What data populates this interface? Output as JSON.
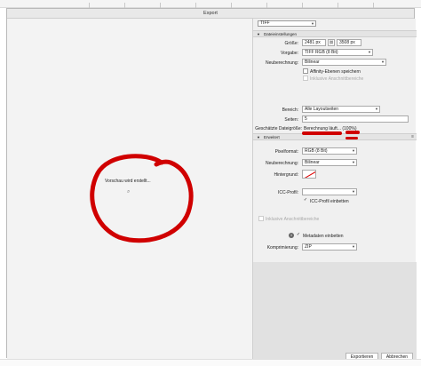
{
  "window": {
    "title": "Export"
  },
  "preview": {
    "status_text": "Vorschau wird erstellt..."
  },
  "format": {
    "selected": "TIFF"
  },
  "file_settings": {
    "header": "Dateieinstellungen",
    "size_label": "Größe:",
    "width_value": "2481 px",
    "height_value": "3508 px",
    "preset_label": "Vorgabe:",
    "preset_value": "TIFF RGB (8 Bit)",
    "resample_label": "Neuberechnung:",
    "resample_value": "Bilinear",
    "affinity_layers_label": "Affinity-Ebenen speichern",
    "bleed_label": "Inklusive Anschnittbereiche",
    "area_label": "Bereich:",
    "area_value": "Alle Layoutseiten",
    "pages_label": "Seiten:",
    "pages_value": "5",
    "filesize_label": "Geschätzte Dateigröße:",
    "filesize_value": "Berechnung läuft... (100%)"
  },
  "advanced": {
    "header": "Erweitert",
    "pixel_format_label": "Pixelformat:",
    "pixel_format_value": "RGB (8 Bit)",
    "resample_label": "Neuberechnung:",
    "resample_value": "Bilinear",
    "background_label": "Hintergrund:",
    "icc_label": "ICC-Profil:",
    "icc_value": "",
    "embed_icc_label": "ICC-Profil einbetten",
    "bleed_label": "Inklusive Anschnittbereiche",
    "metadata_label": "Metadaten einbetten",
    "compression_label": "Komprimierung:",
    "compression_value": "ZIP"
  },
  "buttons": {
    "export": "Exportieren",
    "cancel": "Abbrechen"
  },
  "colors": {
    "annotation_red": "#d00000",
    "panel_bg": "#f0f0f0"
  }
}
